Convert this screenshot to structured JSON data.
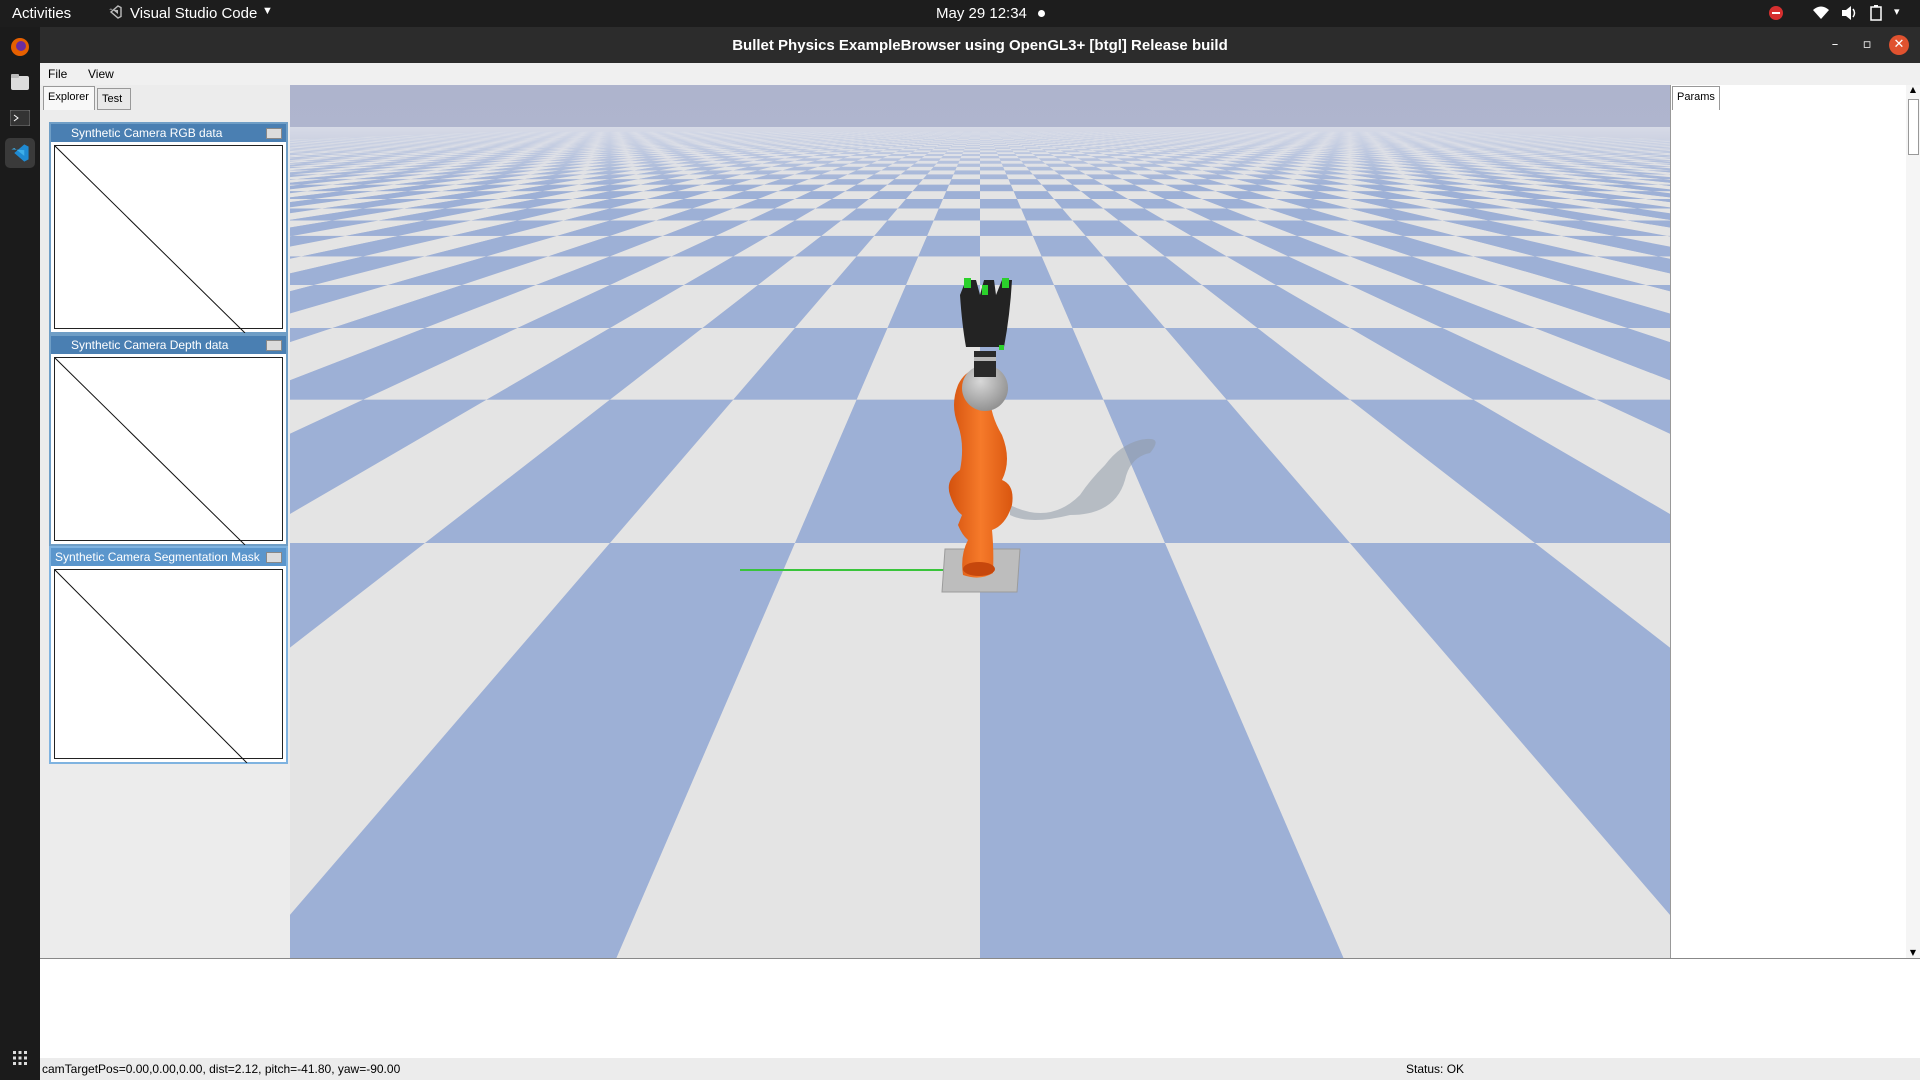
{
  "topbar": {
    "activities": "Activities",
    "app_name": "Visual Studio Code",
    "clock": "May 29  12:34"
  },
  "window": {
    "title": "Bullet Physics ExampleBrowser using OpenGL3+ [btgl] Release build"
  },
  "menu": {
    "file": "File",
    "view": "View"
  },
  "left_tabs": {
    "explorer": "Explorer",
    "test": "Test"
  },
  "camera_windows": {
    "rgb": "Synthetic Camera RGB data",
    "depth": "Synthetic Camera Depth data",
    "seg": "Synthetic Camera Segmentation Mask"
  },
  "right_tabs": {
    "params": "Params"
  },
  "status": {
    "camera": "camTargetPos=0.00,0.00,0.00, dist=2.12, pitch=-41.80, yaw=-90.00",
    "state": "Status: OK"
  },
  "colors": {
    "floor_blue": "#9db0d6",
    "floor_light": "#e4e4e4",
    "robot_orange": "#f06a1c",
    "sky": "#aeb4cd"
  },
  "icons": [
    "firefox-icon",
    "files-icon",
    "terminal-icon",
    "vscode-icon",
    "app-grid-icon",
    "dnd-icon",
    "wifi-icon",
    "volume-icon",
    "battery-icon"
  ]
}
